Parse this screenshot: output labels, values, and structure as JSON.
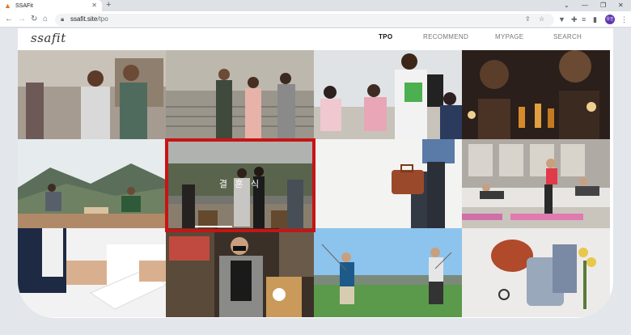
{
  "browser": {
    "tab_title": "SSAFit",
    "url_host": "ssafit.site",
    "url_path": "/tpo",
    "profile_initials": "유진"
  },
  "site": {
    "logo": "ssafit",
    "nav": [
      "TPO",
      "RECOMMEND",
      "MYPAGE",
      "SEARCH"
    ],
    "active_nav": "TPO"
  },
  "tiles": {
    "selected_label": "결 혼 식",
    "scenes": [
      "couple-walking-street",
      "friends-walking-stairs",
      "classroom-students",
      "party-drinks",
      "mountain-picnic",
      "wedding",
      "businessman-briefcase",
      "fitness-workout",
      "business-contract-signing",
      "street-fashion-man",
      "golf-course",
      "flat-lay-outfit"
    ]
  },
  "colors": {
    "selection_border": "#c81414",
    "page_bg": "#e3e7ec"
  }
}
